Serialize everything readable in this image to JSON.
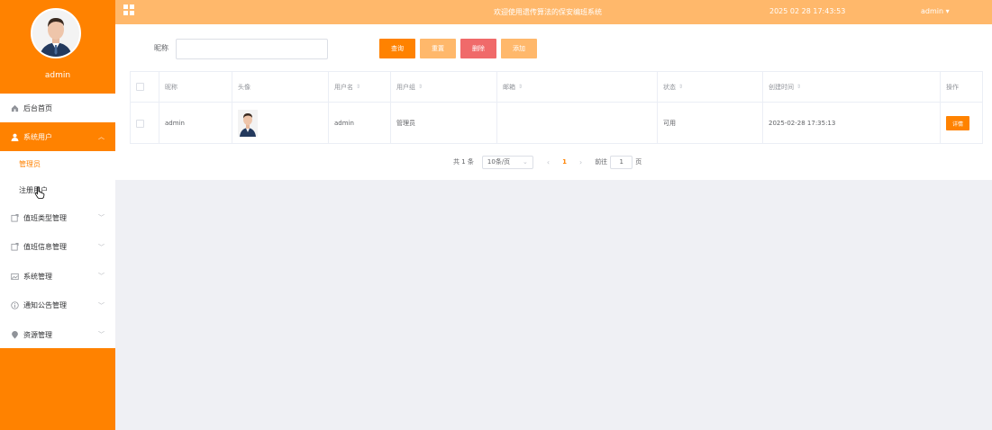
{
  "sidebar": {
    "username": "admin",
    "menu": [
      {
        "label": "后台首页",
        "icon": "home-icon"
      },
      {
        "label": "系统用户",
        "icon": "user-icon"
      },
      {
        "label": "值班类型管理",
        "icon": "doc-icon"
      },
      {
        "label": "值班信息管理",
        "icon": "doc-icon"
      },
      {
        "label": "系统管理",
        "icon": "image-icon"
      },
      {
        "label": "通知公告管理",
        "icon": "info-icon"
      },
      {
        "label": "资源管理",
        "icon": "location-icon"
      }
    ],
    "submenu": [
      {
        "label": "管理员"
      },
      {
        "label": "注册用户"
      }
    ]
  },
  "topbar": {
    "welcome": "欢迎使用遗传算法的保安编班系统",
    "datetime": "2025 02 28 17:43:53",
    "user": "admin"
  },
  "search": {
    "label": "昵称",
    "value": "",
    "buttons": {
      "query": "查询",
      "reset": "重置",
      "delete": "删除",
      "add": "添加"
    }
  },
  "table": {
    "headers": [
      "昵称",
      "头像",
      "用户名",
      "用户组",
      "邮箱",
      "状态",
      "创建时间",
      "操作"
    ],
    "rows": [
      {
        "nickname": "admin",
        "username": "admin",
        "group": "管理员",
        "email": "",
        "status": "可用",
        "created": "2025-02-28 17:35:13",
        "action": "详情"
      }
    ]
  },
  "pagination": {
    "total": "共 1 条",
    "page_size": "10条/页",
    "current": "1",
    "goto_label": "前往",
    "goto_value": "1",
    "goto_suffix": "页"
  },
  "colors": {
    "primary": "#ff8200",
    "light": "#ffb86b",
    "danger": "#f06a6a"
  }
}
